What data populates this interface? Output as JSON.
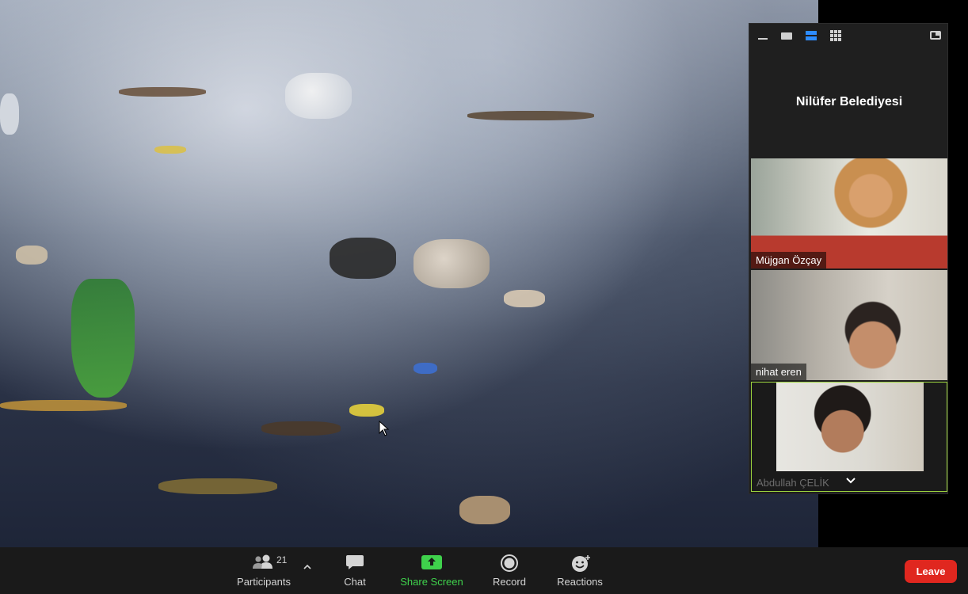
{
  "meeting": {
    "host_label": "Nilüfer Belediyesi",
    "participants": [
      {
        "name": "Müjgan Özçay"
      },
      {
        "name": "nihat eren"
      },
      {
        "name": "Abdullah ÇELİK"
      }
    ]
  },
  "panel_controls": {
    "icons": [
      "minimize-icon",
      "filmstrip-icon",
      "speaker-view-icon",
      "gallery-view-icon",
      "exit-fullscreen-icon"
    ]
  },
  "toolbar": {
    "participants_label": "Participants",
    "participants_count": "21",
    "chat_label": "Chat",
    "share_label": "Share Screen",
    "record_label": "Record",
    "reactions_label": "Reactions",
    "leave_label": "Leave"
  },
  "colors": {
    "share_green": "#3fd14c",
    "leave_red": "#e0271f",
    "active_speaker_border": "#9bd23d",
    "active_view_blue": "#2d8cff"
  }
}
